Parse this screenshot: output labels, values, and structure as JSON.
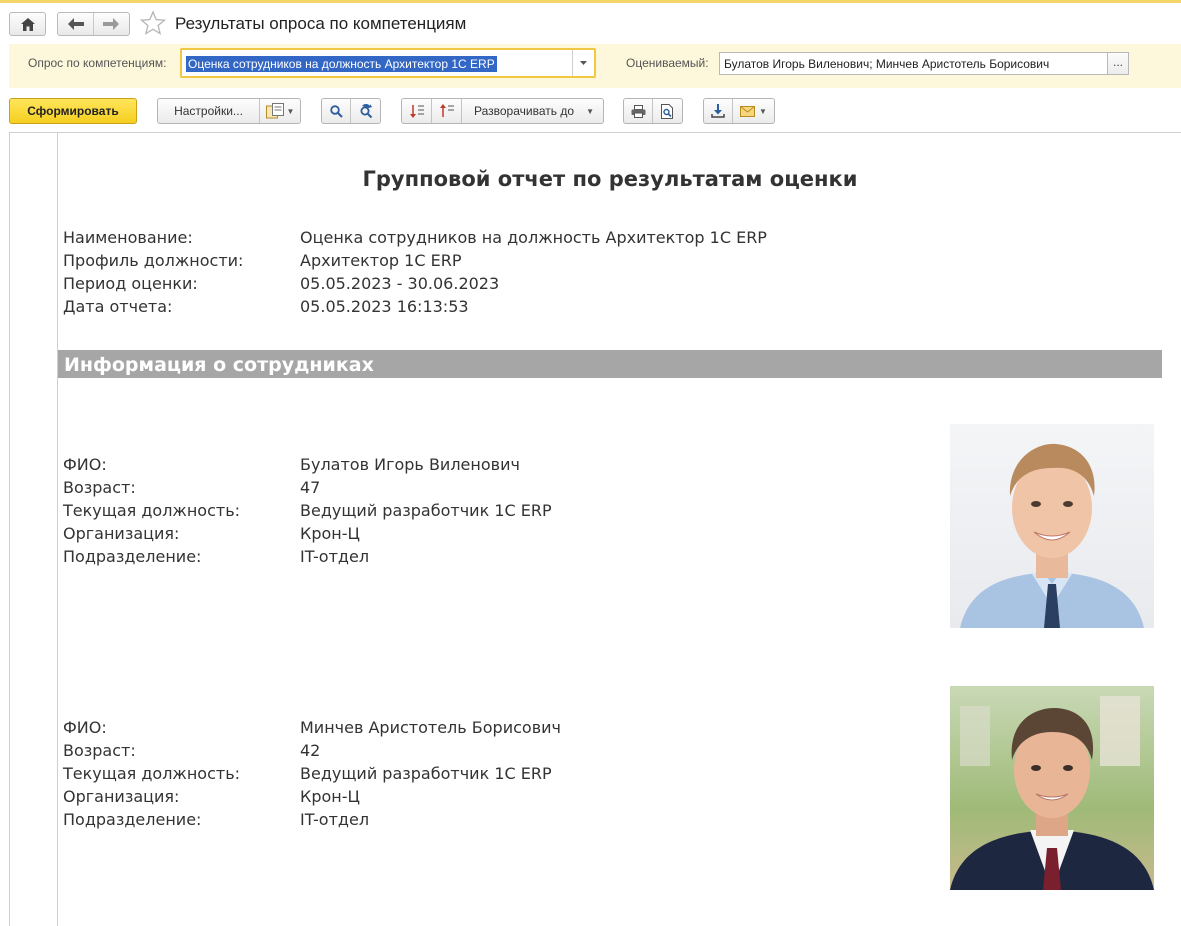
{
  "window": {
    "title": "Результаты опроса по компетенциям"
  },
  "params": {
    "survey_label": "Опрос по компетенциям:",
    "survey_value": "Оценка сотрудников на должность Архитектор 1С ERP",
    "evaluated_label": "Оцениваемый:",
    "evaluated_value": "Булатов Игорь Виленович; Минчев Аристотель Борисович",
    "evaluated_more": "..."
  },
  "toolbar": {
    "generate_label": "Сформировать",
    "settings_label": "Настройки...",
    "expand_label": "Разворачивать до"
  },
  "report": {
    "title": "Групповой отчет по результатам оценки",
    "header": [
      {
        "label": "Наименование:",
        "value": "Оценка сотрудников на должность Архитектор 1С ERP"
      },
      {
        "label": "Профиль должности:",
        "value": "Архитектор 1С ERP"
      },
      {
        "label": "Период оценки:",
        "value": "05.05.2023 - 30.06.2023"
      },
      {
        "label": "Дата отчета:",
        "value": "05.05.2023 16:13:53"
      }
    ],
    "section_title": "Информация о сотрудниках",
    "employees": [
      {
        "fields": [
          {
            "label": "ФИО:",
            "value": "Булатов Игорь Виленович"
          },
          {
            "label": "Возраст:",
            "value": "47"
          },
          {
            "label": "Текущая должность:",
            "value": "Ведущий разработчик 1С ERP"
          },
          {
            "label": "Организация:",
            "value": "Крон-Ц"
          },
          {
            "label": "Подразделение:",
            "value": "IT-отдел"
          }
        ]
      },
      {
        "fields": [
          {
            "label": "ФИО:",
            "value": "Минчев Аристотель Борисович"
          },
          {
            "label": "Возраст:",
            "value": "42"
          },
          {
            "label": "Текущая должность:",
            "value": "Ведущий разработчик 1С ERP"
          },
          {
            "label": "Организация:",
            "value": "Крон-Ц"
          },
          {
            "label": "Подразделение:",
            "value": "IT-отдел"
          }
        ]
      }
    ]
  },
  "colors": {
    "accent_yellow": "#f5cf1f",
    "param_band": "#fdf8dc",
    "selection_blue": "#3367c6",
    "section_gray": "#a6a6a6"
  }
}
